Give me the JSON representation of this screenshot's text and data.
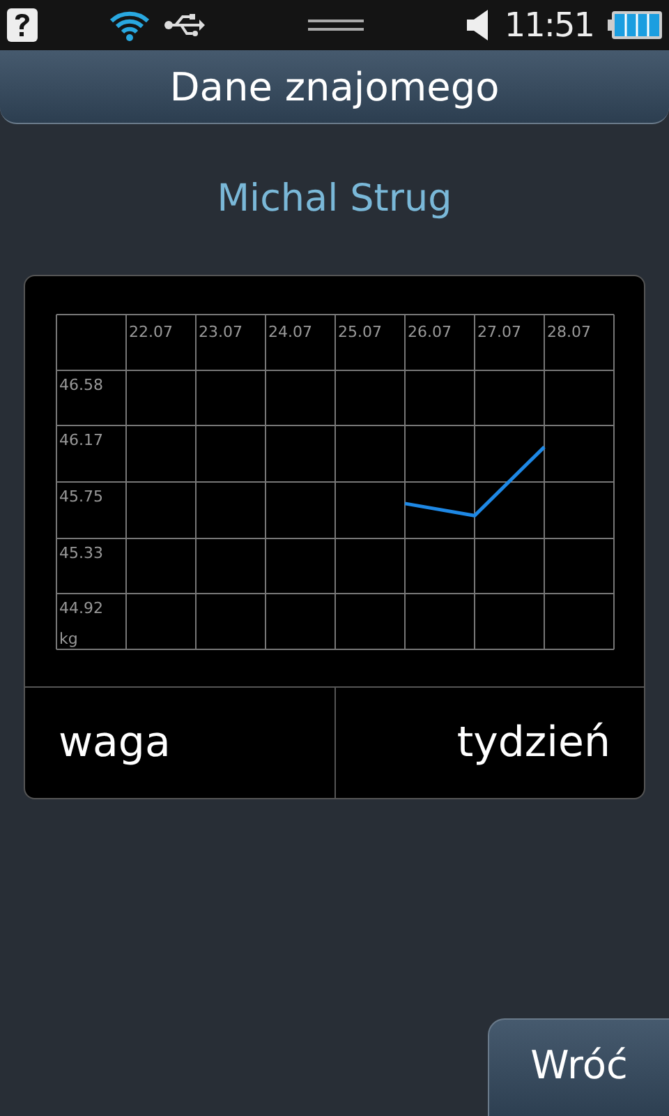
{
  "status_bar": {
    "time": "11:51"
  },
  "header": {
    "title": "Dane znajomego"
  },
  "contact": {
    "name": "Michal Strug"
  },
  "chart": {
    "unit": "kg",
    "chart_data": {
      "type": "line",
      "categories": [
        "22.07",
        "23.07",
        "24.07",
        "25.07",
        "26.07",
        "27.07",
        "28.07"
      ],
      "series": [
        {
          "name": "waga",
          "color": "#1e88e5",
          "values": [
            null,
            null,
            null,
            null,
            45.59,
            45.5,
            46.01
          ]
        }
      ],
      "ylim": [
        44.505,
        46.995
      ],
      "grid": true,
      "yticks": [
        46.58,
        46.17,
        45.75,
        45.33,
        44.92
      ]
    }
  },
  "period": {
    "label": "tydzień"
  },
  "back_button": {
    "label": "Wróć"
  }
}
